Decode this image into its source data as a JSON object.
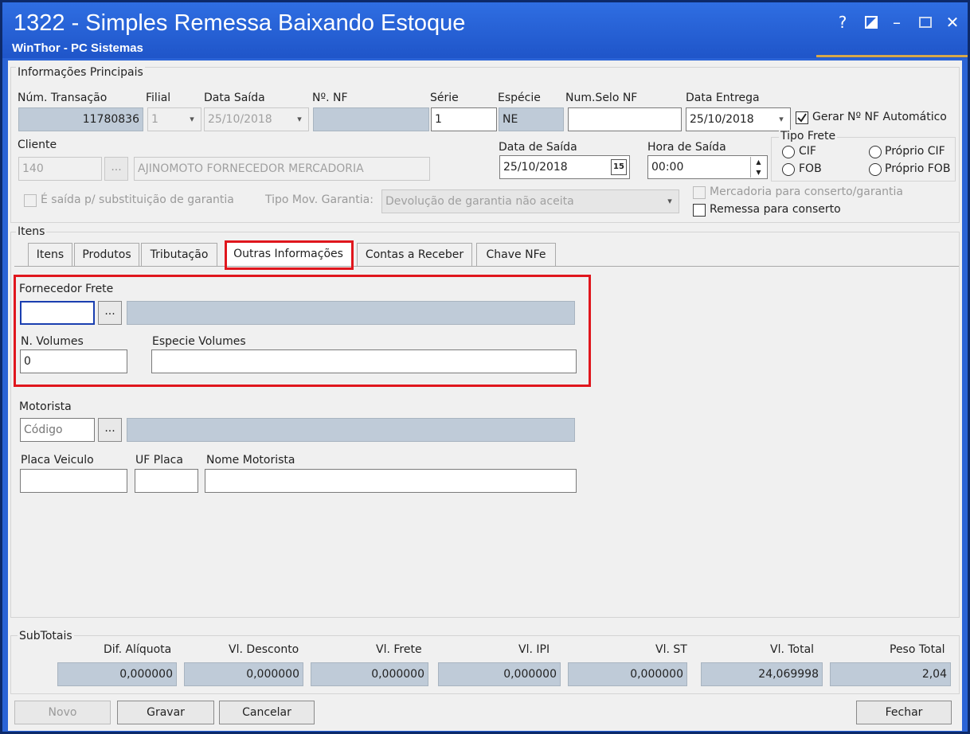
{
  "window": {
    "title": "1322 - Simples Remessa Baixando Estoque",
    "subtitle": "WinThor - PC Sistemas",
    "help": "?",
    "minimize": "–",
    "close": "✕"
  },
  "principais": {
    "group_label": "Informações Principais",
    "num_transacao_label": "Núm. Transação",
    "num_transacao_value": "11780836",
    "filial_label": "Filial",
    "filial_value": "1",
    "data_saida_label": "Data Saída",
    "data_saida_value": "25/10/2018",
    "nf_label": "Nº. NF",
    "nf_value": "",
    "serie_label": "Série",
    "serie_value": "1",
    "especie_label": "Espécie",
    "especie_value": "NE",
    "num_selo_label": "Num.Selo NF",
    "num_selo_value": "",
    "data_entrega_label": "Data Entrega",
    "data_entrega_value": "25/10/2018",
    "gerar_nf_label": "Gerar Nº NF Automático",
    "gerar_nf_checked": true,
    "cliente_label": "Cliente",
    "cliente_code": "140",
    "cliente_button": "...",
    "cliente_name": "AJINOMOTO FORNECEDOR MERCADORIA",
    "data_de_saida_label": "Data de Saída",
    "data_de_saida_value": "25/10/2018",
    "calendar_button": "15",
    "hora_saida_label": "Hora de Saída",
    "hora_saida_value": "00:00",
    "tipo_frete_label": "Tipo Frete",
    "frete_cif": "CIF",
    "frete_fob": "FOB",
    "frete_proprio_cif": "Próprio CIF",
    "frete_proprio_fob": "Próprio FOB",
    "garantia_label": "É saída p/ substituição de garantia",
    "tipo_mov_label": "Tipo Mov. Garantia:",
    "tipo_mov_value": "Devolução de garantia não aceita",
    "conserto_garantia_label": "Mercadoria para conserto/garantia",
    "remessa_conserto_label": "Remessa para conserto"
  },
  "itens": {
    "group_label": "Itens",
    "tabs": [
      "Itens",
      "Produtos",
      "Tributação",
      "Outras Informações",
      "Contas a Receber",
      "Chave NFe"
    ],
    "active_tab": "Outras Informações"
  },
  "outras": {
    "fornecedor_label": "Fornecedor Frete",
    "fornecedor_code": "",
    "fornecedor_button": "...",
    "fornecedor_name": "",
    "volumes_label": "N. Volumes",
    "volumes_value": "0",
    "especie_volumes_label": "Especie Volumes",
    "especie_volumes_value": "",
    "motorista_label": "Motorista",
    "motorista_placeholder": "Código",
    "motorista_button": "...",
    "motorista_name": "",
    "placa_label": "Placa Veiculo",
    "uf_placa_label": "UF Placa",
    "nome_motorista_label": "Nome Motorista"
  },
  "subtotais": {
    "group_label": "SubTotais",
    "fields": [
      {
        "label": "Dif. Alíquota",
        "value": "0,000000"
      },
      {
        "label": "Vl. Desconto",
        "value": "0,000000"
      },
      {
        "label": "Vl. Frete",
        "value": "0,000000"
      },
      {
        "label": "Vl. IPI",
        "value": "0,000000"
      },
      {
        "label": "Vl. ST",
        "value": "0,000000"
      },
      {
        "label": "Vl. Total",
        "value": "24,069998"
      },
      {
        "label": "Peso Total",
        "value": "2,04"
      }
    ]
  },
  "buttons": {
    "novo": "Novo",
    "gravar": "Gravar",
    "cancelar": "Cancelar",
    "fechar": "Fechar"
  }
}
